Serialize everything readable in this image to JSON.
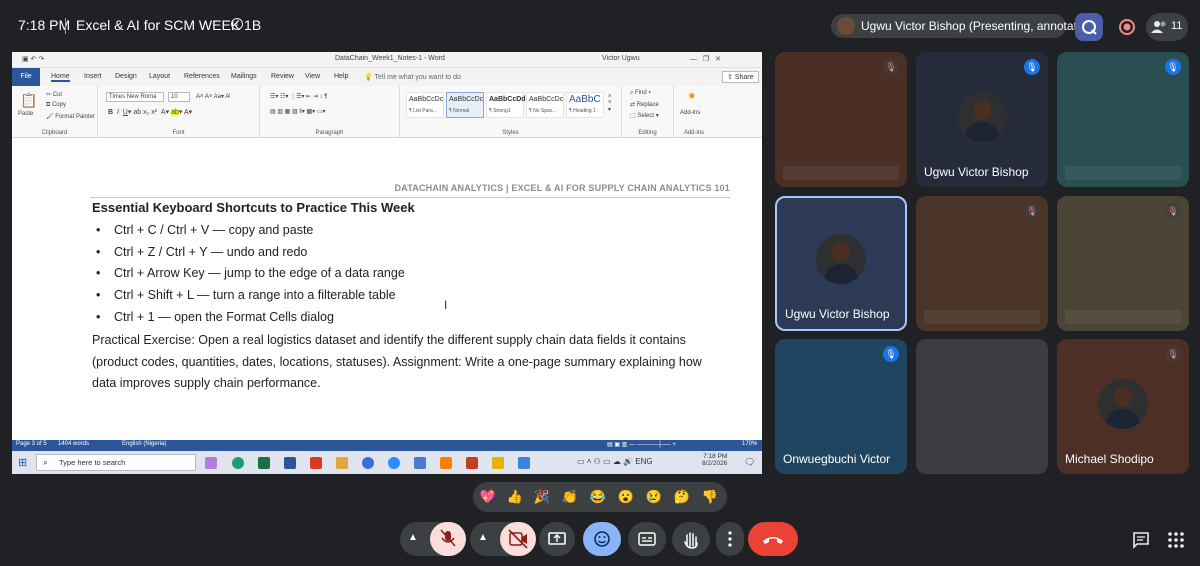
{
  "meet": {
    "time": "7:18 PM",
    "meeting_title": "Excel & AI for SCM WEEK 1B",
    "presenter_chip": "Ugwu Victor Bishop (Presenting, annotating)",
    "participant_count": "11"
  },
  "word": {
    "doc_title": "DataChain_Week1_Notes-1  -  Word",
    "user": "Victor Ugwu",
    "tabs": [
      "File",
      "Home",
      "Insert",
      "Design",
      "Layout",
      "References",
      "Mailings",
      "Review",
      "View",
      "Help"
    ],
    "tell_me": "Tell me what you want to do",
    "share": "Share",
    "ribbon": {
      "paste": "Paste",
      "cut": "Cut",
      "copy": "Copy",
      "format_painter": "Format Painter",
      "clipboard": "Clipboard",
      "font_name": "Times New Roma",
      "font_size": "10",
      "font": "Font",
      "paragraph": "Paragraph",
      "styles_label": "Styles",
      "styles": [
        {
          "sample": "AaBbCcDc",
          "name": "¶ List Para..."
        },
        {
          "sample": "AaBbCcDc",
          "name": "¶ Normal"
        },
        {
          "sample": "AaBbCcDd",
          "name": "¶ Strong1"
        },
        {
          "sample": "AaBbCcDc",
          "name": "¶ No Spac..."
        },
        {
          "sample": "AaBbC",
          "name": "¶ Heading 1"
        }
      ],
      "find": "Find",
      "replace": "Replace",
      "select": "Select",
      "editing": "Editing",
      "addins": "Add-ins",
      "addins_group": "Add-ins"
    },
    "document": {
      "header": "DATACHAIN ANALYTICS  |  EXCEL & AI FOR SUPPLY CHAIN ANALYTICS 101",
      "heading": "Essential Keyboard Shortcuts to Practice This Week",
      "bullets": [
        "Ctrl + C / Ctrl + V — copy and paste",
        "Ctrl + Z / Ctrl + Y — undo and redo",
        "Ctrl + Arrow Key — jump to the edge of a data range",
        "Ctrl + Shift + L — turn a range into a filterable table",
        "Ctrl + 1 — open the Format Cells dialog"
      ],
      "paragraph": "Practical Exercise: Open a real logistics dataset and identify the different supply chain data fields it contains (product codes, quantities, dates, locations, statuses). Assignment: Write a one-page summary explaining how data improves supply chain performance."
    },
    "status": {
      "page": "Page 3 of 5",
      "words": "1404 words",
      "language": "English (Nigeria)",
      "zoom": "170%"
    },
    "taskbar": {
      "search_placeholder": "Type here to search",
      "clock_time": "7:18 PM",
      "clock_date": "8/2/2026"
    }
  },
  "tiles": [
    {
      "name": ""
    },
    {
      "name": "Ugwu Victor Bishop"
    },
    {
      "name": ""
    },
    {
      "name": "Ugwu Victor Bishop"
    },
    {
      "name": ""
    },
    {
      "name": ""
    },
    {
      "name": "Onwuegbuchi Victor"
    },
    {
      "name": ""
    },
    {
      "name": "Michael Shodipo"
    }
  ],
  "reactions": [
    "💖",
    "👍",
    "🎉",
    "👏",
    "😂",
    "😮",
    "😢",
    "🤔",
    "👎"
  ],
  "colors": {
    "meet_bg": "#202124",
    "word_blue": "#2b579a",
    "end_call": "#ea4335",
    "active_tile_border": "#a8c7fa"
  }
}
